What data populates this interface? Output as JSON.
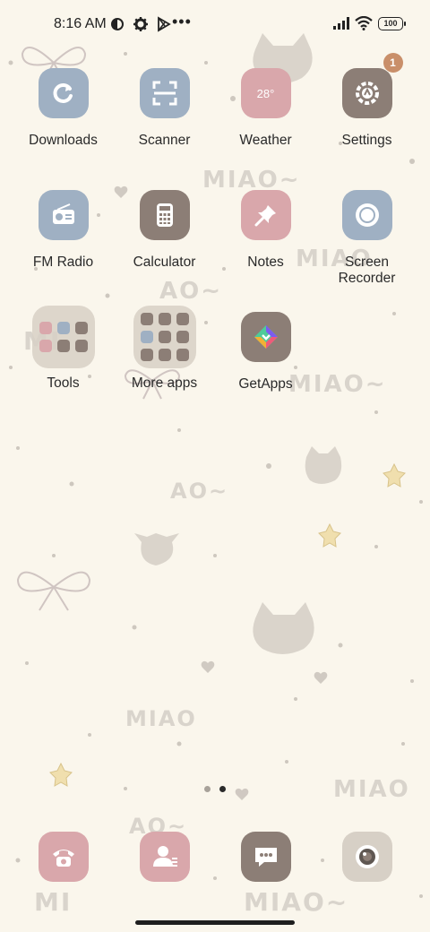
{
  "status_bar": {
    "time": "8:16 AM",
    "left_icons": [
      "data-saver-icon",
      "gear-icon",
      "play-store-icon"
    ],
    "overflow": "•••",
    "battery": "100"
  },
  "apps": [
    {
      "label": "Downloads",
      "icon": "download-icon",
      "color": "#9fb0c3"
    },
    {
      "label": "Scanner",
      "icon": "scanner-icon",
      "color": "#9fb0c3"
    },
    {
      "label": "Weather",
      "icon": "weather-icon",
      "color": "#d9a7ab",
      "icon_text": "28°"
    },
    {
      "label": "Settings",
      "icon": "settings-icon",
      "color": "#8c7e76",
      "badge": "1"
    },
    {
      "label": "FM Radio",
      "icon": "radio-icon",
      "color": "#9fb0c3"
    },
    {
      "label": "Calculator",
      "icon": "calculator-icon",
      "color": "#8c7e76"
    },
    {
      "label": "Notes",
      "icon": "pin-icon",
      "color": "#d9a7ab"
    },
    {
      "label": "Screen\nRecorder",
      "icon": "record-icon",
      "color": "#9fb0c3"
    },
    {
      "label": "Tools",
      "icon": "folder-icon",
      "color": "#d7d0c6"
    },
    {
      "label": "More apps",
      "icon": "folder-icon",
      "color": "#d7d0c6"
    },
    {
      "label": "GetApps",
      "icon": "getapps-icon",
      "color": "#8c7e76"
    }
  ],
  "dock": [
    {
      "name": "phone",
      "icon": "phone-icon",
      "color": "#d9a7ab"
    },
    {
      "name": "contacts",
      "icon": "contacts-icon",
      "color": "#d9a7ab"
    },
    {
      "name": "messages",
      "icon": "message-icon",
      "color": "#8c7e76"
    },
    {
      "name": "camera",
      "icon": "camera-icon",
      "color": "#d7d0c6"
    }
  ],
  "pager": {
    "pages": 2,
    "current": 2
  },
  "wallpaper": {
    "texts": [
      "MIAO~",
      "MIAO",
      "AO~",
      "MI",
      "MIAO~",
      "AO~",
      "MIAO",
      "MIAO",
      "AO~",
      "MI",
      "MIAO~"
    ]
  },
  "colors": {
    "background": "#faf6ec",
    "accent_blue": "#9fb0c3",
    "accent_pink": "#d9a7ab",
    "accent_brown": "#8c7e76",
    "badge": "#c98f6a"
  }
}
